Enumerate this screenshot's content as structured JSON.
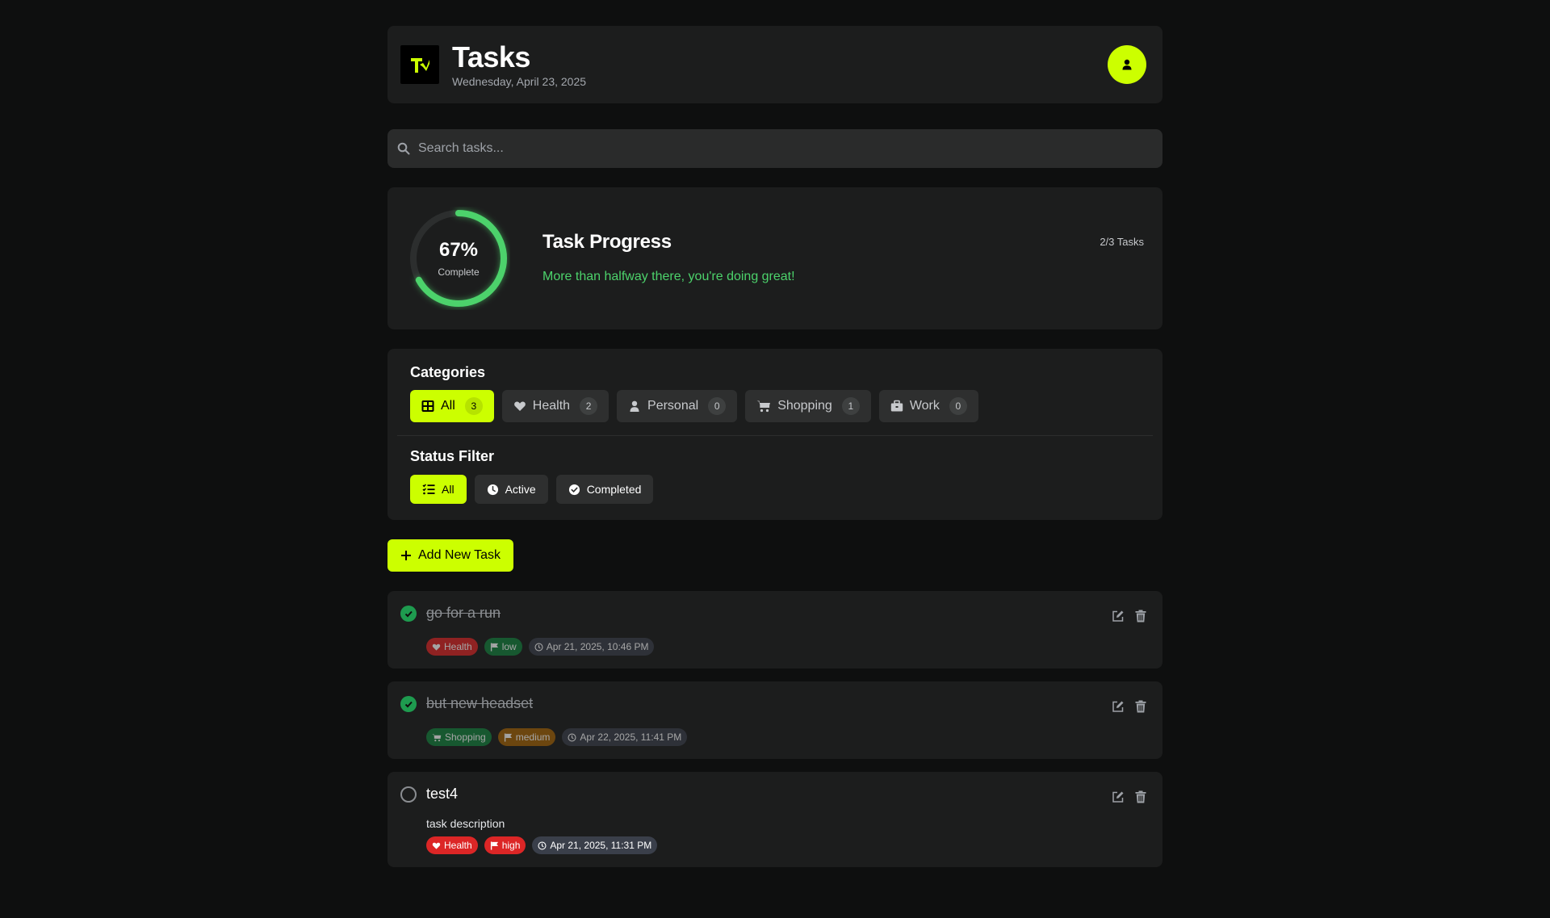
{
  "header": {
    "title": "Tasks",
    "date": "Wednesday, April 23, 2025",
    "logo_icon": "tasks-logo-icon",
    "avatar_icon": "user-icon"
  },
  "search": {
    "placeholder": "Search tasks...",
    "value": ""
  },
  "progress": {
    "percent_label": "67%",
    "percent_value": 67,
    "complete_label": "Complete",
    "title": "Task Progress",
    "message": "More than halfway there, you're doing great!",
    "count": "2/3 Tasks"
  },
  "categories": {
    "title": "Categories",
    "items": [
      {
        "label": "All",
        "count": "3",
        "icon": "grid-icon",
        "active": true
      },
      {
        "label": "Health",
        "count": "2",
        "icon": "heart-icon",
        "active": false
      },
      {
        "label": "Personal",
        "count": "0",
        "icon": "user-icon",
        "active": false
      },
      {
        "label": "Shopping",
        "count": "1",
        "icon": "cart-icon",
        "active": false
      },
      {
        "label": "Work",
        "count": "0",
        "icon": "briefcase-icon",
        "active": false
      }
    ]
  },
  "status_filter": {
    "title": "Status Filter",
    "items": [
      {
        "label": "All",
        "icon": "list-check-icon",
        "active": true
      },
      {
        "label": "Active",
        "icon": "clock-icon",
        "active": false
      },
      {
        "label": "Completed",
        "icon": "check-circle-icon",
        "active": false
      }
    ]
  },
  "add_button": {
    "label": "Add New Task"
  },
  "tasks": [
    {
      "title": "go for a run",
      "done": true,
      "description": "",
      "category": "Health",
      "priority": "low",
      "datetime": "Apr 21, 2025, 10:46 PM"
    },
    {
      "title": "but new headset",
      "done": true,
      "description": "",
      "category": "Shopping",
      "priority": "medium",
      "datetime": "Apr 22, 2025, 11:41 PM"
    },
    {
      "title": "test4",
      "done": false,
      "description": "task description",
      "category": "Health",
      "priority": "high",
      "datetime": "Apr 21, 2025, 11:31 PM"
    }
  ],
  "colors": {
    "accent": "#ccff00",
    "progress_green": "#4cd26b",
    "health_tag": "#dc2626",
    "shopping_tag": "#15803d",
    "priority_low": "#15803d",
    "priority_medium": "#a16207",
    "priority_high": "#dc2626",
    "date_tag": "#3a3f4a"
  }
}
